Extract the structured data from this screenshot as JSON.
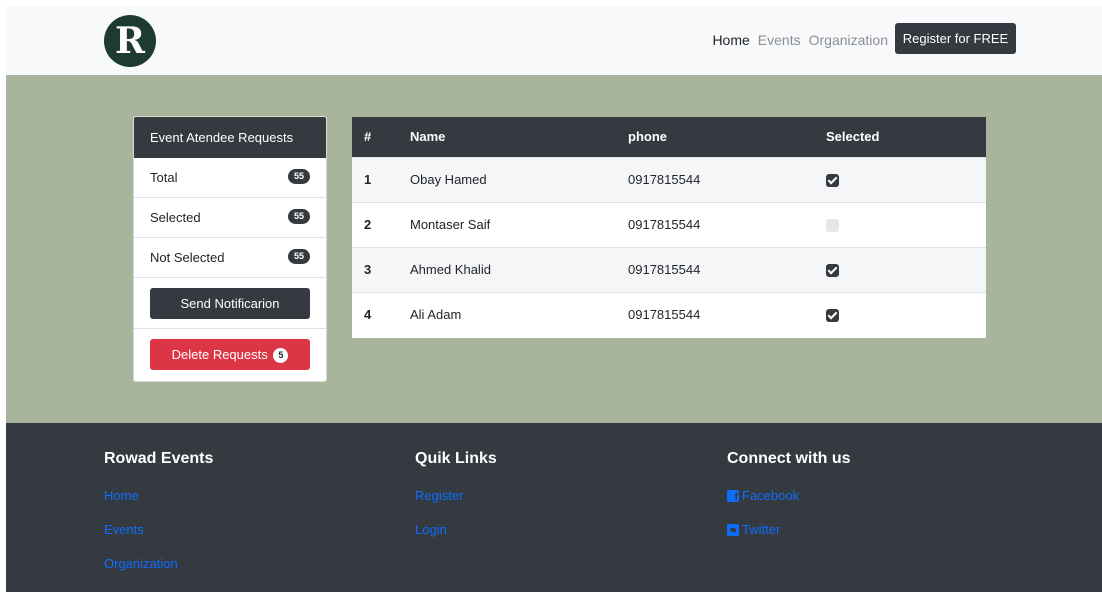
{
  "navbar": {
    "logo_letter": "R",
    "links": [
      "Home",
      "Events",
      "Organization"
    ],
    "register_label": "Register for FREE"
  },
  "sidebar": {
    "title": "Event Atendee Requests",
    "stats": [
      {
        "label": "Total",
        "count": "55"
      },
      {
        "label": "Selected",
        "count": "55"
      },
      {
        "label": "Not Selected",
        "count": "55"
      }
    ],
    "send_label": "Send Notificarion",
    "delete_label": "Delete Requests",
    "delete_count": "5"
  },
  "table": {
    "headers": [
      "#",
      "Name",
      "phone",
      "Selected"
    ],
    "rows": [
      {
        "num": "1",
        "name": "Obay Hamed",
        "phone": "0917815544",
        "selected": true
      },
      {
        "num": "2",
        "name": "Montaser Saif",
        "phone": "0917815544",
        "selected": false
      },
      {
        "num": "3",
        "name": "Ahmed Khalid",
        "phone": "0917815544",
        "selected": true
      },
      {
        "num": "4",
        "name": "Ali Adam",
        "phone": "0917815544",
        "selected": true
      }
    ]
  },
  "footer": {
    "col1": {
      "title": "Rowad Events",
      "links": [
        "Home",
        "Events",
        "Organization"
      ]
    },
    "col2": {
      "title": "Quik Links",
      "links": [
        "Register",
        "Login"
      ]
    },
    "col3": {
      "title": "Connect with us",
      "links": [
        {
          "icon": "facebook-icon",
          "label": "Facebook"
        },
        {
          "icon": "twitter-icon",
          "label": "Twitter"
        }
      ]
    }
  },
  "colors": {
    "hero_bg": "#a8b59c",
    "dark": "#343a40",
    "danger": "#dc3545",
    "link": "#0d6efd"
  }
}
